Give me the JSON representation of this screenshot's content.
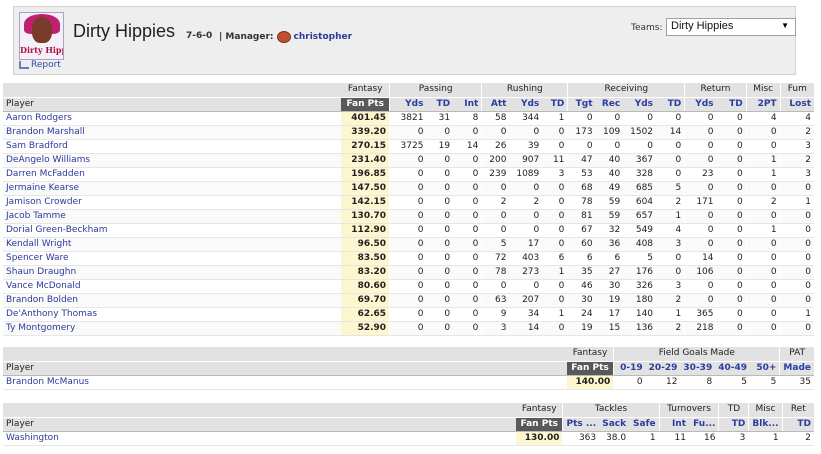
{
  "header": {
    "team_name": "Dirty Hippies",
    "record": "7-6-0",
    "manager_label": "| Manager:",
    "manager_name": "christopher",
    "logo_text": "Dirty Hippie",
    "report_link": "Report",
    "teams_label": "Teams:",
    "teams_selected": "Dirty Hippies"
  },
  "offense": {
    "group_headers": [
      "Fantasy",
      "Passing",
      "Rushing",
      "Receiving",
      "Return",
      "Misc",
      "Fum"
    ],
    "player_header": "Player",
    "sub_headers": [
      "Fan Pts",
      "Yds",
      "TD",
      "Int",
      "Att",
      "Yds",
      "TD",
      "Tgt",
      "Rec",
      "Yds",
      "TD",
      "Yds",
      "TD",
      "2PT",
      "Lost"
    ],
    "rows": [
      {
        "name": "Aaron Rodgers",
        "pts": "401.45",
        "vals": [
          "3821",
          "31",
          "8",
          "58",
          "344",
          "1",
          "0",
          "0",
          "0",
          "0",
          "0",
          "0",
          "4",
          "4"
        ]
      },
      {
        "name": "Brandon Marshall",
        "pts": "339.20",
        "vals": [
          "0",
          "0",
          "0",
          "0",
          "0",
          "0",
          "173",
          "109",
          "1502",
          "14",
          "0",
          "0",
          "0",
          "2"
        ]
      },
      {
        "name": "Sam Bradford",
        "pts": "270.15",
        "vals": [
          "3725",
          "19",
          "14",
          "26",
          "39",
          "0",
          "0",
          "0",
          "0",
          "0",
          "0",
          "0",
          "0",
          "3"
        ]
      },
      {
        "name": "DeAngelo Williams",
        "pts": "231.40",
        "vals": [
          "0",
          "0",
          "0",
          "200",
          "907",
          "11",
          "47",
          "40",
          "367",
          "0",
          "0",
          "0",
          "1",
          "2"
        ]
      },
      {
        "name": "Darren McFadden",
        "pts": "196.85",
        "vals": [
          "0",
          "0",
          "0",
          "239",
          "1089",
          "3",
          "53",
          "40",
          "328",
          "0",
          "23",
          "0",
          "1",
          "3"
        ]
      },
      {
        "name": "Jermaine Kearse",
        "pts": "147.50",
        "vals": [
          "0",
          "0",
          "0",
          "0",
          "0",
          "0",
          "68",
          "49",
          "685",
          "5",
          "0",
          "0",
          "0",
          "0"
        ]
      },
      {
        "name": "Jamison Crowder",
        "pts": "142.15",
        "vals": [
          "0",
          "0",
          "0",
          "2",
          "2",
          "0",
          "78",
          "59",
          "604",
          "2",
          "171",
          "0",
          "2",
          "1"
        ]
      },
      {
        "name": "Jacob Tamme",
        "pts": "130.70",
        "vals": [
          "0",
          "0",
          "0",
          "0",
          "0",
          "0",
          "81",
          "59",
          "657",
          "1",
          "0",
          "0",
          "0",
          "0"
        ]
      },
      {
        "name": "Dorial Green-Beckham",
        "pts": "112.90",
        "vals": [
          "0",
          "0",
          "0",
          "0",
          "0",
          "0",
          "67",
          "32",
          "549",
          "4",
          "0",
          "0",
          "1",
          "0"
        ]
      },
      {
        "name": "Kendall Wright",
        "pts": "96.50",
        "vals": [
          "0",
          "0",
          "0",
          "5",
          "17",
          "0",
          "60",
          "36",
          "408",
          "3",
          "0",
          "0",
          "0",
          "0"
        ]
      },
      {
        "name": "Spencer Ware",
        "pts": "83.50",
        "vals": [
          "0",
          "0",
          "0",
          "72",
          "403",
          "6",
          "6",
          "6",
          "5",
          "0",
          "14",
          "0",
          "0",
          "0"
        ]
      },
      {
        "name": "Shaun Draughn",
        "pts": "83.20",
        "vals": [
          "0",
          "0",
          "0",
          "78",
          "273",
          "1",
          "35",
          "27",
          "176",
          "0",
          "106",
          "0",
          "0",
          "0"
        ]
      },
      {
        "name": "Vance McDonald",
        "pts": "80.60",
        "vals": [
          "0",
          "0",
          "0",
          "0",
          "0",
          "0",
          "46",
          "30",
          "326",
          "3",
          "0",
          "0",
          "0",
          "0"
        ]
      },
      {
        "name": "Brandon Bolden",
        "pts": "69.70",
        "vals": [
          "0",
          "0",
          "0",
          "63",
          "207",
          "0",
          "30",
          "19",
          "180",
          "2",
          "0",
          "0",
          "0",
          "0"
        ]
      },
      {
        "name": "De'Anthony Thomas",
        "pts": "62.65",
        "vals": [
          "0",
          "0",
          "0",
          "9",
          "34",
          "1",
          "24",
          "17",
          "140",
          "1",
          "365",
          "0",
          "0",
          "1"
        ]
      },
      {
        "name": "Ty Montgomery",
        "pts": "52.90",
        "vals": [
          "0",
          "0",
          "0",
          "3",
          "14",
          "0",
          "19",
          "15",
          "136",
          "2",
          "218",
          "0",
          "0",
          "0"
        ]
      }
    ]
  },
  "kicker": {
    "group_headers": [
      "Fantasy",
      "Field Goals Made",
      "PAT"
    ],
    "player_header": "Player",
    "sub_headers": [
      "Fan Pts",
      "0-19",
      "20-29",
      "30-39",
      "40-49",
      "50+",
      "Made"
    ],
    "rows": [
      {
        "name": "Brandon McManus",
        "pts": "140.00",
        "vals": [
          "0",
          "12",
          "8",
          "5",
          "5",
          "35"
        ]
      }
    ]
  },
  "defense": {
    "group_headers": [
      "Fantasy",
      "Tackles",
      "Turnovers",
      "TD",
      "Misc",
      "Ret"
    ],
    "player_header": "Player",
    "sub_headers": [
      "Fan Pts",
      "Pts ...",
      "Sack",
      "Safe",
      "Int",
      "Fu...",
      "TD",
      "Blk...",
      "TD"
    ],
    "rows": [
      {
        "name": "Washington",
        "pts": "130.00",
        "vals": [
          "363",
          "38.0",
          "1",
          "11",
          "16",
          "3",
          "1",
          "2"
        ]
      }
    ]
  },
  "colors": {
    "header_bg": "#eeeeee",
    "fan_pts_header": "#595959",
    "fan_pts_cell": "#fdf6cf",
    "link": "#2b3a9a"
  }
}
